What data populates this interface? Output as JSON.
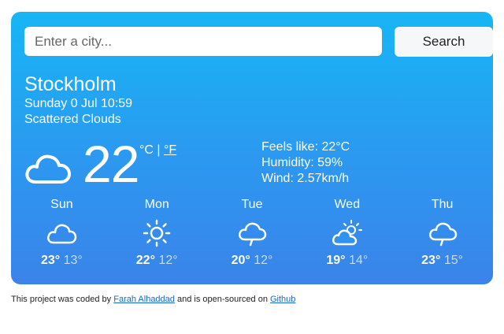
{
  "search": {
    "placeholder": "Enter a city...",
    "value": "",
    "button_label": "Search"
  },
  "current": {
    "city": "Stockholm",
    "date": "Sunday 0 Jul 10:59",
    "description": "Scattered Clouds",
    "icon": "cloud-icon",
    "temperature": "22",
    "unit_c": "°C",
    "unit_separator": " | ",
    "unit_f": "°F",
    "feels_like": "Feels like: 22°C",
    "humidity": "Humidity: 59%",
    "wind": "Wind: 2.57km/h"
  },
  "forecast": [
    {
      "day": "Sun",
      "icon": "cloud-icon",
      "max": "23°",
      "min": "13°"
    },
    {
      "day": "Mon",
      "icon": "sun-icon",
      "max": "22°",
      "min": "12°"
    },
    {
      "day": "Tue",
      "icon": "rain-cloud-icon",
      "max": "20°",
      "min": "12°"
    },
    {
      "day": "Wed",
      "icon": "partly-cloudy-icon",
      "max": "19°",
      "min": "14°"
    },
    {
      "day": "Thu",
      "icon": "rain-cloud-icon",
      "max": "23°",
      "min": "15°"
    }
  ],
  "footer": {
    "prefix": "This project was coded by ",
    "author": "Farah Alhaddad",
    "middle": " and is open-sourced on ",
    "repo_link": "Github"
  },
  "colors": {
    "gradient_top": "#17b6f5",
    "gradient_bottom": "#3b83e9",
    "link": "#1a66d6",
    "min_temp": "#c7dcf6"
  }
}
